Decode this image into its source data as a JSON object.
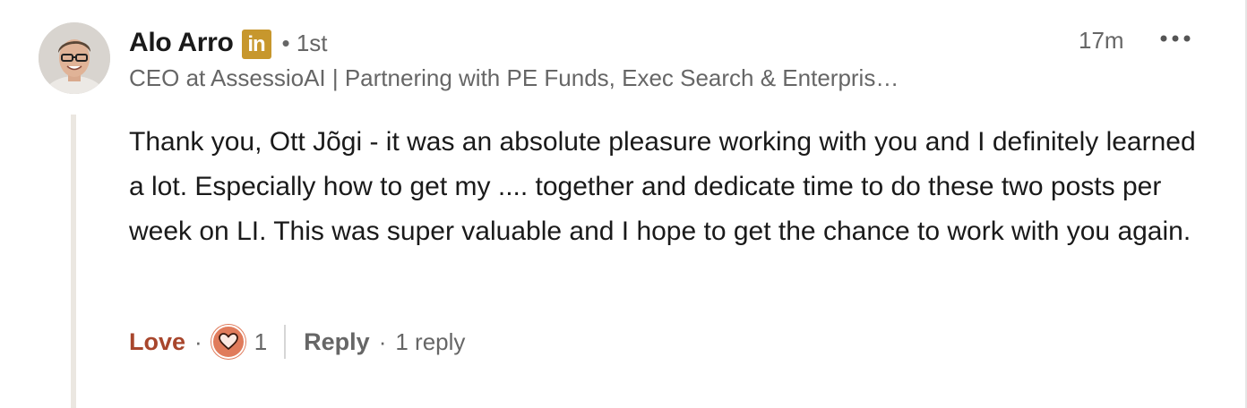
{
  "comment": {
    "author": {
      "name": "Alo Arro",
      "badge_icon": "linkedin-icon",
      "badge_text": "in",
      "connection_degree": "1st",
      "headline": "CEO at AssessioAI | Partnering with PE Funds, Exec Search & Enterpris…"
    },
    "separator": "•",
    "timestamp": "17m",
    "more_icon": "more-horizontal-icon",
    "text": "Thank you, Ott Jõgi - it was an absolute pleasure working with you and I definitely learned a lot. Especially how to get my .... together and dedicate time to do these two posts per week on LI. This was super valuable and I hope to get the chance to work with you again.",
    "actions": {
      "love_label": "Love",
      "dot": "·",
      "reaction_icon": "love-reaction-icon",
      "reaction_count": "1",
      "reply_label": "Reply",
      "reply_count": "1 reply"
    }
  },
  "colors": {
    "love": "#a8462c",
    "reaction_bg": "#e07b5b",
    "badge": "#c7972d",
    "secondary_text": "#666666",
    "thread_line": "#ebe7e1"
  }
}
